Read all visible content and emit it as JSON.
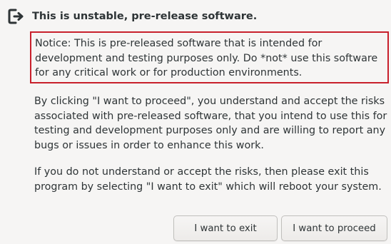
{
  "header": {
    "icon": "exit-icon",
    "title": "This is unstable, pre-release software."
  },
  "notice": {
    "text": "Notice: This is pre-released software that is intended for development and testing purposes only.  Do *not* use this software for any critical work or for production environments.",
    "border_color": "#c8202c"
  },
  "body": {
    "paragraph1": "By clicking \"I want to proceed\", you understand and accept the risks associated with pre-released software, that you intend to use this for testing and development purposes only and are willing to report any bugs or issues in order to enhance this work.",
    "paragraph2": "If you do not understand or accept the risks, then please exit this program by selecting \"I want to exit\" which will reboot your system."
  },
  "buttons": {
    "exit_label": "I want to exit",
    "proceed_label": "I want to proceed"
  }
}
